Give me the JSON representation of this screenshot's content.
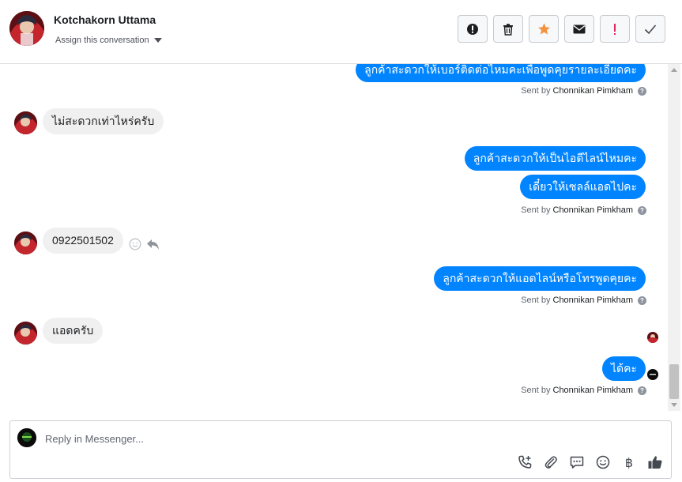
{
  "header": {
    "contact_name": "Kotchakorn Uttama",
    "assign_label": "Assign this conversation",
    "actions": [
      {
        "name": "spam-icon"
      },
      {
        "name": "trash-icon"
      },
      {
        "name": "star-icon",
        "color": "#f5923e"
      },
      {
        "name": "mail-icon"
      },
      {
        "name": "important-icon",
        "color": "#e0245e"
      },
      {
        "name": "done-check-icon"
      }
    ]
  },
  "thread": {
    "messages": [
      {
        "from": "page",
        "text": "ลูกค้าสะดวกให้เบอร์ติดต่อไหมคะเพื่อพูดคุยรายละเอียดคะ"
      },
      {
        "from": "customer",
        "text": "ไม่สะดวกเท่าไหร่ครับ"
      },
      {
        "from": "page",
        "text": "ลูกค้าสะดวกให้เป็นไอดีไลน์ไหมคะ"
      },
      {
        "from": "page",
        "text": "เดี๋ยวให้เซลล์แอดไปคะ"
      },
      {
        "from": "customer",
        "text": "0922501502"
      },
      {
        "from": "page",
        "text": "ลูกค้าสะดวกให้แอดไลน์หรือโทรพูดคุยคะ"
      },
      {
        "from": "customer",
        "text": "แอดครับ"
      },
      {
        "from": "page",
        "text": "ได้คะ"
      }
    ],
    "sent_by_prefix": "Sent by",
    "sent_by_name": "Chonnikan Pimkham",
    "help_glyph": "?"
  },
  "composer": {
    "placeholder": "Reply in Messenger...",
    "value": "",
    "baht_symbol": "฿",
    "tools": [
      "call-add-icon",
      "attach-icon",
      "saved-replies-icon",
      "emoji-icon",
      "baht-payment-icon",
      "like-icon"
    ]
  },
  "colors": {
    "outgoing_bubble": "#0084ff",
    "incoming_bubble": "#f1f0f0",
    "accent_star": "#f5923e",
    "accent_important": "#e0245e"
  }
}
